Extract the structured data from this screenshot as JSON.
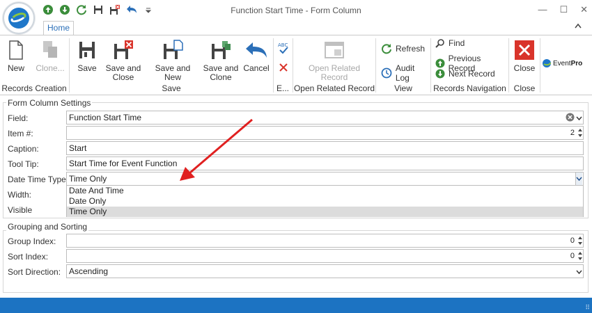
{
  "window": {
    "title": "Function Start Time - Form Column"
  },
  "qat": [
    "arrow-up-icon",
    "arrow-down-icon",
    "refresh-icon",
    "save-icon",
    "save-close-icon",
    "undo-icon",
    "customize-dropdown-icon"
  ],
  "tabs": {
    "home": "Home"
  },
  "ribbon": {
    "records_creation": {
      "label": "Records Creation",
      "new": "New",
      "clone": "Clone..."
    },
    "save": {
      "label": "Save",
      "save": "Save",
      "save_close_1": "Save and",
      "save_close_2": "Close",
      "save_new": "Save and New",
      "save_clone_1": "Save and",
      "save_clone_2": "Clone",
      "cancel": "Cancel"
    },
    "edit": {
      "label": "E..."
    },
    "open_related": {
      "label": "Open Related Record",
      "button_1": "Open Related",
      "button_2": "Record"
    },
    "view": {
      "label": "View",
      "refresh": "Refresh",
      "audit_log": "Audit Log"
    },
    "records_navigation": {
      "label": "Records Navigation",
      "find": "Find",
      "previous": "Previous Record",
      "next": "Next Record"
    },
    "close": {
      "label": "Close",
      "close": "Close"
    },
    "brand": {
      "text_1": "Event",
      "text_2": "Pro"
    }
  },
  "form_column_settings": {
    "legend": "Form Column Settings",
    "field_label": "Field:",
    "field_value": "Function Start Time",
    "item_label": "Item #:",
    "item_value": "2",
    "caption_label": "Caption:",
    "caption_value": "Start",
    "tooltip_label": "Tool Tip:",
    "tooltip_value": "Start Time for Event Function",
    "dtt_label": "Date Time Type:",
    "dtt_value": "Time Only",
    "width_label": "Width:",
    "visible_label": "Visible",
    "dtt_options": [
      "Date And Time",
      "Date Only",
      "Time Only"
    ]
  },
  "grouping_sorting": {
    "legend": "Grouping and Sorting",
    "group_index_label": "Group Index:",
    "group_index_value": "0",
    "sort_index_label": "Sort Index:",
    "sort_index_value": "0",
    "sort_direction_label": "Sort Direction:",
    "sort_direction_value": "Ascending"
  },
  "colors": {
    "accent": "#1c73c2",
    "annotation_arrow": "#e02020"
  }
}
